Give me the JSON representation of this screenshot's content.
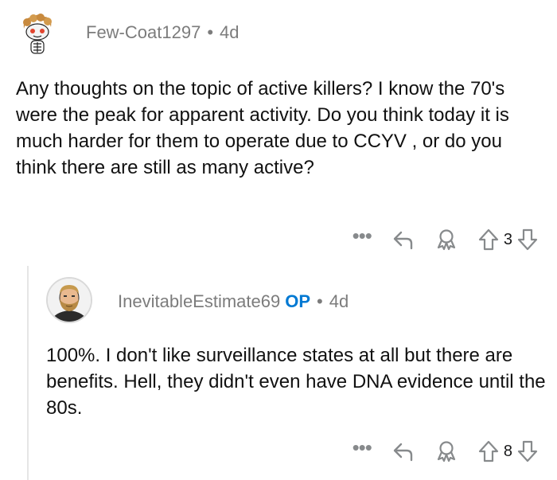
{
  "comments": [
    {
      "username": "Few-Coat1297",
      "separator": "•",
      "age": "4d",
      "op_badge": "",
      "body": "Any thoughts on the topic of active killers? I know the 70's were the peak for apparent activity. Do you think today it is much harder for them to operate due to CCYV , or do you think there are still as many active?",
      "more": "•••",
      "score": "3",
      "icons": [
        "more-icon",
        "reply-arrow-icon",
        "award-icon",
        "upvote-arrow-icon",
        "downvote-arrow-icon"
      ]
    },
    {
      "username": "InevitableEstimate69",
      "separator": "•",
      "age": "4d",
      "op_badge": "OP",
      "body": "100%. I don't like surveillance states at all but there are benefits. Hell, they didn't even have DNA evidence until the 80s.",
      "more": "•••",
      "score": "8",
      "icons": [
        "more-icon",
        "reply-arrow-icon",
        "award-icon",
        "upvote-arrow-icon",
        "downvote-arrow-icon"
      ]
    }
  ],
  "colors": {
    "meta_gray": "#7c7c7c",
    "icon_gray": "#878a8c",
    "op_blue": "#0079d3",
    "thread_line": "#e6e6e6",
    "text": "#111111"
  }
}
